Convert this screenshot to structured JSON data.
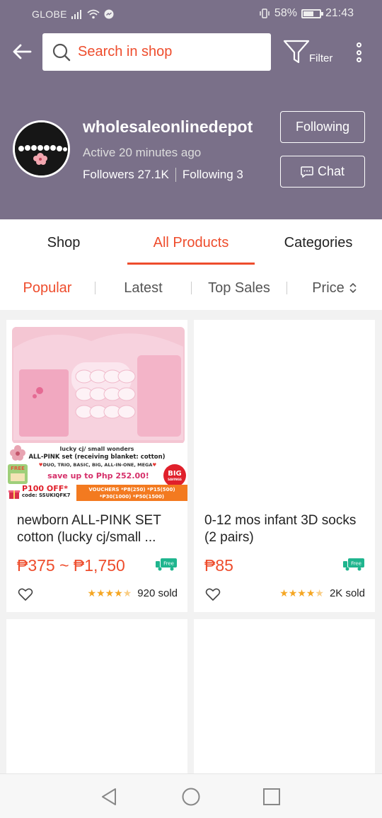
{
  "status_bar": {
    "carrier": "GLOBE",
    "battery_percent": "58%",
    "battery_level": 0.58,
    "time": "21:43"
  },
  "header": {
    "search_placeholder": "Search in shop",
    "filter_label": "Filter"
  },
  "shop": {
    "name": "wholesaleonlinedepot",
    "active_status": "Active 20 minutes ago",
    "followers": "Followers 27.1K",
    "following": "Following 3",
    "following_button": "Following",
    "chat_button": "Chat"
  },
  "tabs": [
    {
      "label": "Shop",
      "active": false
    },
    {
      "label": "All Products",
      "active": true
    },
    {
      "label": "Categories",
      "active": false
    }
  ],
  "sort": [
    {
      "label": "Popular",
      "active": true
    },
    {
      "label": "Latest",
      "active": false
    },
    {
      "label": "Top Sales",
      "active": false
    },
    {
      "label": "Price",
      "active": false
    }
  ],
  "products": [
    {
      "title": "newborn ALL-PINK SET cotton (lucky cj/small ...",
      "price": "₱375 ~ ₱1,750",
      "rating": 4.5,
      "sold": "920 sold",
      "banner": {
        "line1": "lucky cj/ small wonders",
        "line2": "ALL-PINK set (receiving blanket: cotton)",
        "line3": "DUO, TRIO, BASIC, BIG, ALL-IN-ONE, MEGA",
        "line4": "save up to Php 252.00!",
        "badge": "BIG",
        "badge_sub": "SAVINGS",
        "free_tag": "FREE",
        "promo": "P100 OFF*",
        "code": "code: SSUKIQFK7",
        "vouchers1": "VOUCHERS *P8(250) *P15(500)",
        "vouchers2": "*P30(1000) *P50(1500)"
      }
    },
    {
      "title": "0-12 mos infant 3D socks (2 pairs)",
      "price": "₱85",
      "rating": 4.5,
      "sold": "2K sold"
    }
  ],
  "free_shipping_label": "Free",
  "colors": {
    "header_bg": "#7a7089",
    "accent": "#ee4d2d",
    "star": "#f5a623",
    "shipping_green": "#1fb58e"
  }
}
